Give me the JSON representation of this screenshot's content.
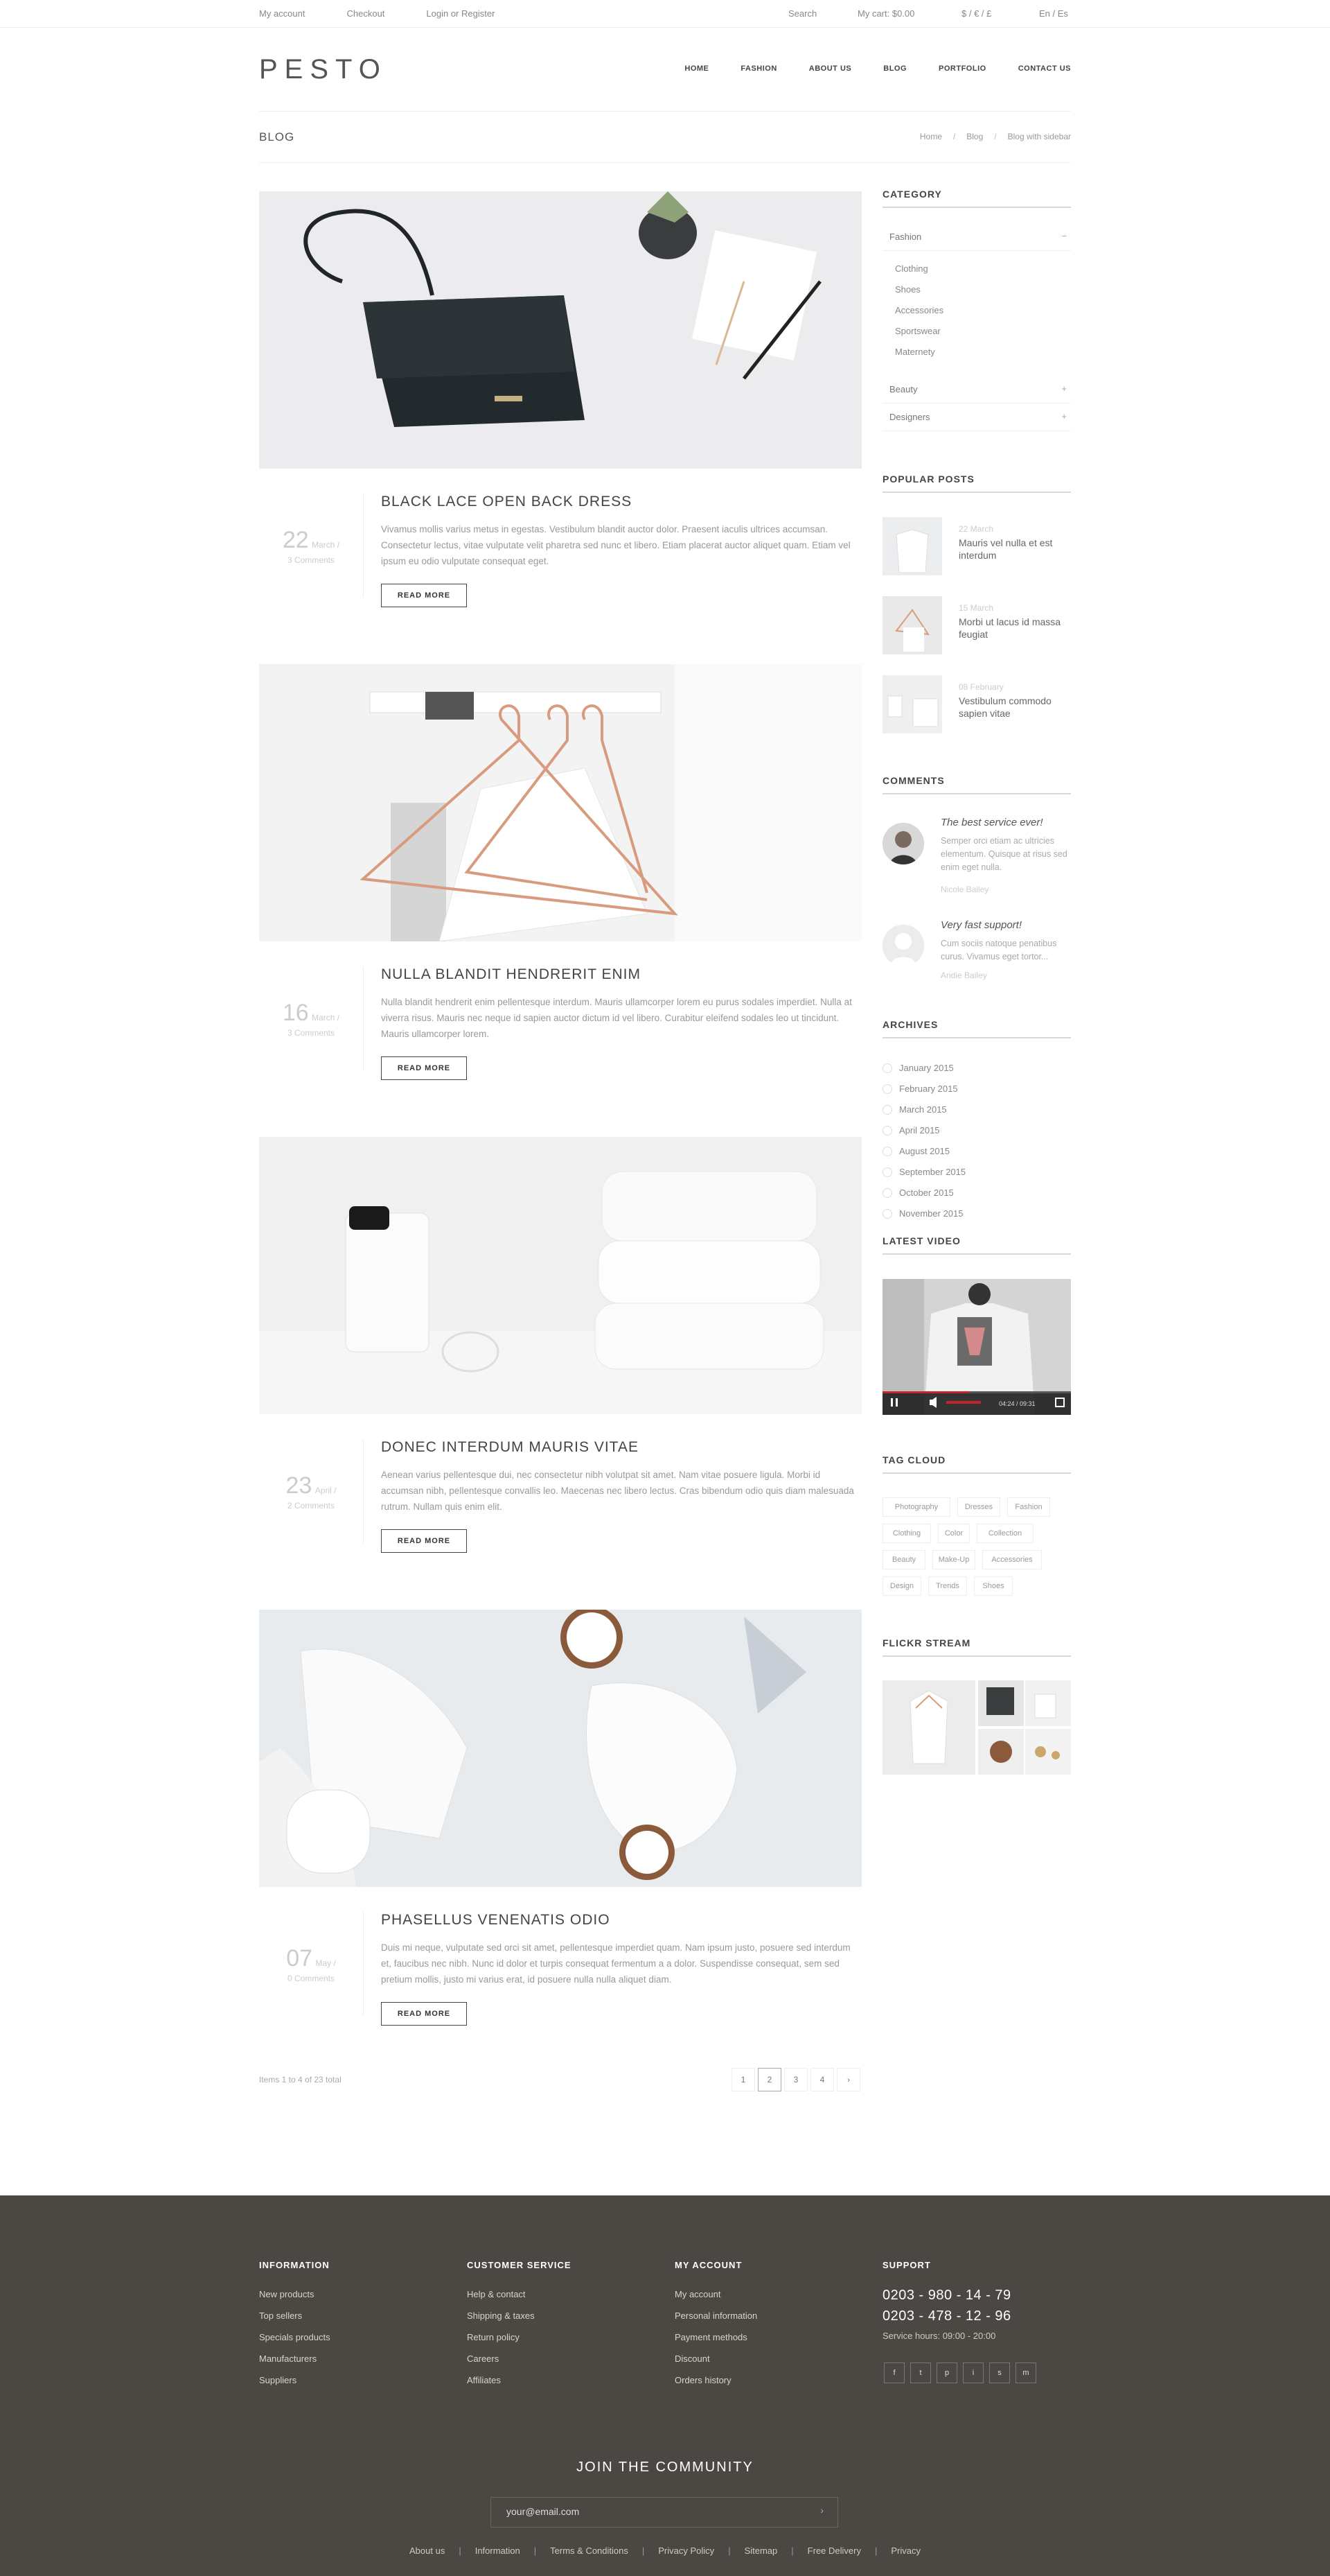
{
  "topbar": {
    "my_account": "My account",
    "checkout": "Checkout",
    "login": "Login or Register",
    "search": "Search",
    "cart": "My cart: $0.00",
    "currency": "$ / € / £",
    "lang": "En / Es"
  },
  "header": {
    "logo": "PESTO",
    "nav": [
      "HOME",
      "FASHION",
      "ABOUT US",
      "BLOG",
      "PORTFOLIO",
      "CONTACT US"
    ]
  },
  "page": {
    "title": "BLOG",
    "breadcrumb": [
      "Home",
      "Blog",
      "Blog with sidebar"
    ],
    "breadcrumb_sep": "/"
  },
  "posts": [
    {
      "day": "22",
      "month": "March /",
      "comments": "3 Comments",
      "title": "BLACK LACE OPEN BACK DRESS",
      "text": "Vivamus mollis varius metus in egestas. Vestibulum blandit auctor dolor. Praesent iaculis ultrices accumsan. Consectetur lectus, vitae vulputate velit pharetra sed nunc et libero. Etiam placerat auctor aliquet quam. Etiam vel ipsum eu odio vulputate consequat eget.",
      "read_more": "READ MORE"
    },
    {
      "day": "16",
      "month": "March /",
      "comments": "3 Comments",
      "title": "NULLA BLANDIT HENDRERIT ENIM",
      "text": "Nulla blandit hendrerit enim pellentesque interdum. Mauris ullamcorper lorem eu purus sodales imperdiet. Nulla at viverra risus. Mauris nec neque id sapien auctor dictum id vel libero. Curabitur eleifend sodales leo ut tincidunt. Mauris ullamcorper lorem.",
      "read_more": "READ MORE"
    },
    {
      "day": "23",
      "month": "April /",
      "comments": "2 Comments",
      "title": "DONEC INTERDUM MAURIS VITAE",
      "text": "Aenean varius pellentesque dui, nec consectetur nibh volutpat sit amet. Nam vitae posuere ligula. Morbi id accumsan nibh, pellentesque convallis leo. Maecenas nec libero lectus. Cras bibendum odio quis diam malesuada rutrum. Nullam quis enim elit.",
      "read_more": "READ MORE"
    },
    {
      "day": "07",
      "month": "May /",
      "comments": "0 Comments",
      "title": "PHASELLUS VENENATIS ODIO",
      "text": "Duis mi neque, vulputate sed orci sit amet, pellentesque imperdiet quam. Nam ipsum justo, posuere sed interdum et, faucibus nec nibh. Nunc id dolor et turpis consequat fermentum a a dolor. Suspendisse consequat, sem sed pretium mollis, justo mi varius erat, id posuere nulla nulla aliquet diam.",
      "read_more": "READ MORE"
    }
  ],
  "pagination": {
    "summary": "Items 1 to 4 of 23 total",
    "pages": [
      "1",
      "2",
      "3",
      "4"
    ],
    "current": "2",
    "next": "›"
  },
  "sidebar": {
    "category": {
      "heading": "CATEGORY",
      "open": "Fashion",
      "open_toggle": "−",
      "subs": [
        "Clothing",
        "Shoes",
        "Accessories",
        "Sportswear",
        "Maternety"
      ],
      "closed": [
        {
          "label": "Beauty",
          "toggle": "+"
        },
        {
          "label": "Designers",
          "toggle": "+"
        }
      ]
    },
    "popular": {
      "heading": "POPULAR POSTS",
      "items": [
        {
          "date": "22 March",
          "title": "Mauris vel nulla et est interdum"
        },
        {
          "date": "15 March",
          "title": "Morbi ut lacus id massa feugiat"
        },
        {
          "date": "08 February",
          "title": "Vestibulum commodo sapien vitae"
        }
      ]
    },
    "comments": {
      "heading": "COMMENTS",
      "items": [
        {
          "title": "The best service ever!",
          "text": "Semper orci etiam ac ultricies elementum. Quisque at risus sed enim eget nulla.",
          "name": "Nicole Bailey"
        },
        {
          "title": "Very fast support!",
          "text": "Cum sociis natoque penatibus curus. Vivamus eget tortor...",
          "name": "Andie Bailey"
        }
      ]
    },
    "archives": {
      "heading": "ARCHIVES",
      "items": [
        "January 2015",
        "February 2015",
        "March 2015",
        "April 2015",
        "August 2015",
        "September 2015",
        "October 2015",
        "November 2015"
      ]
    },
    "video": {
      "heading": "LATEST VIDEO",
      "time": "04:24 / 09:31",
      "progress": 0.46
    },
    "tags": {
      "heading": "TAG CLOUD",
      "items": [
        "Photography",
        "Dresses",
        "Fashion",
        "Clothing",
        "Color",
        "Collection",
        "Beauty",
        "Make-Up",
        "Accessories",
        "Design",
        "Trends",
        "Shoes"
      ]
    },
    "flickr": {
      "heading": "FLICKR STREAM"
    }
  },
  "footer": {
    "information": {
      "heading": "INFORMATION",
      "links": [
        "New products",
        "Top sellers",
        "Specials products",
        "Manufacturers",
        "Suppliers"
      ]
    },
    "customer_service": {
      "heading": "CUSTOMER SERVICE",
      "links": [
        "Help & contact",
        "Shipping & taxes",
        "Return policy",
        "Careers",
        "Affiliates"
      ]
    },
    "my_account": {
      "heading": "MY ACCOUNT",
      "links": [
        "My account",
        "Personal information",
        "Payment methods",
        "Discount",
        "Orders history"
      ]
    },
    "support": {
      "heading": "SUPPORT",
      "phone1": "0203 - 980 - 14 - 79",
      "phone2": "0203 - 478 - 12 - 96",
      "hours": "Service hours: 09:00 - 20:00",
      "social": [
        "f",
        "t",
        "p",
        "i",
        "s",
        "m"
      ]
    },
    "join": "JOIN THE COMMUNITY",
    "email_placeholder": "your@email.com",
    "email_arrow": "›",
    "bottom_links": [
      "About us",
      "Information",
      "Terms & Conditions",
      "Privacy Policy",
      "Sitemap",
      "Free Delivery",
      "Privacy"
    ],
    "bottom_sep": "|"
  },
  "colors": {
    "footer_bg": "#4b4742",
    "accent_red": "#c0262b"
  }
}
